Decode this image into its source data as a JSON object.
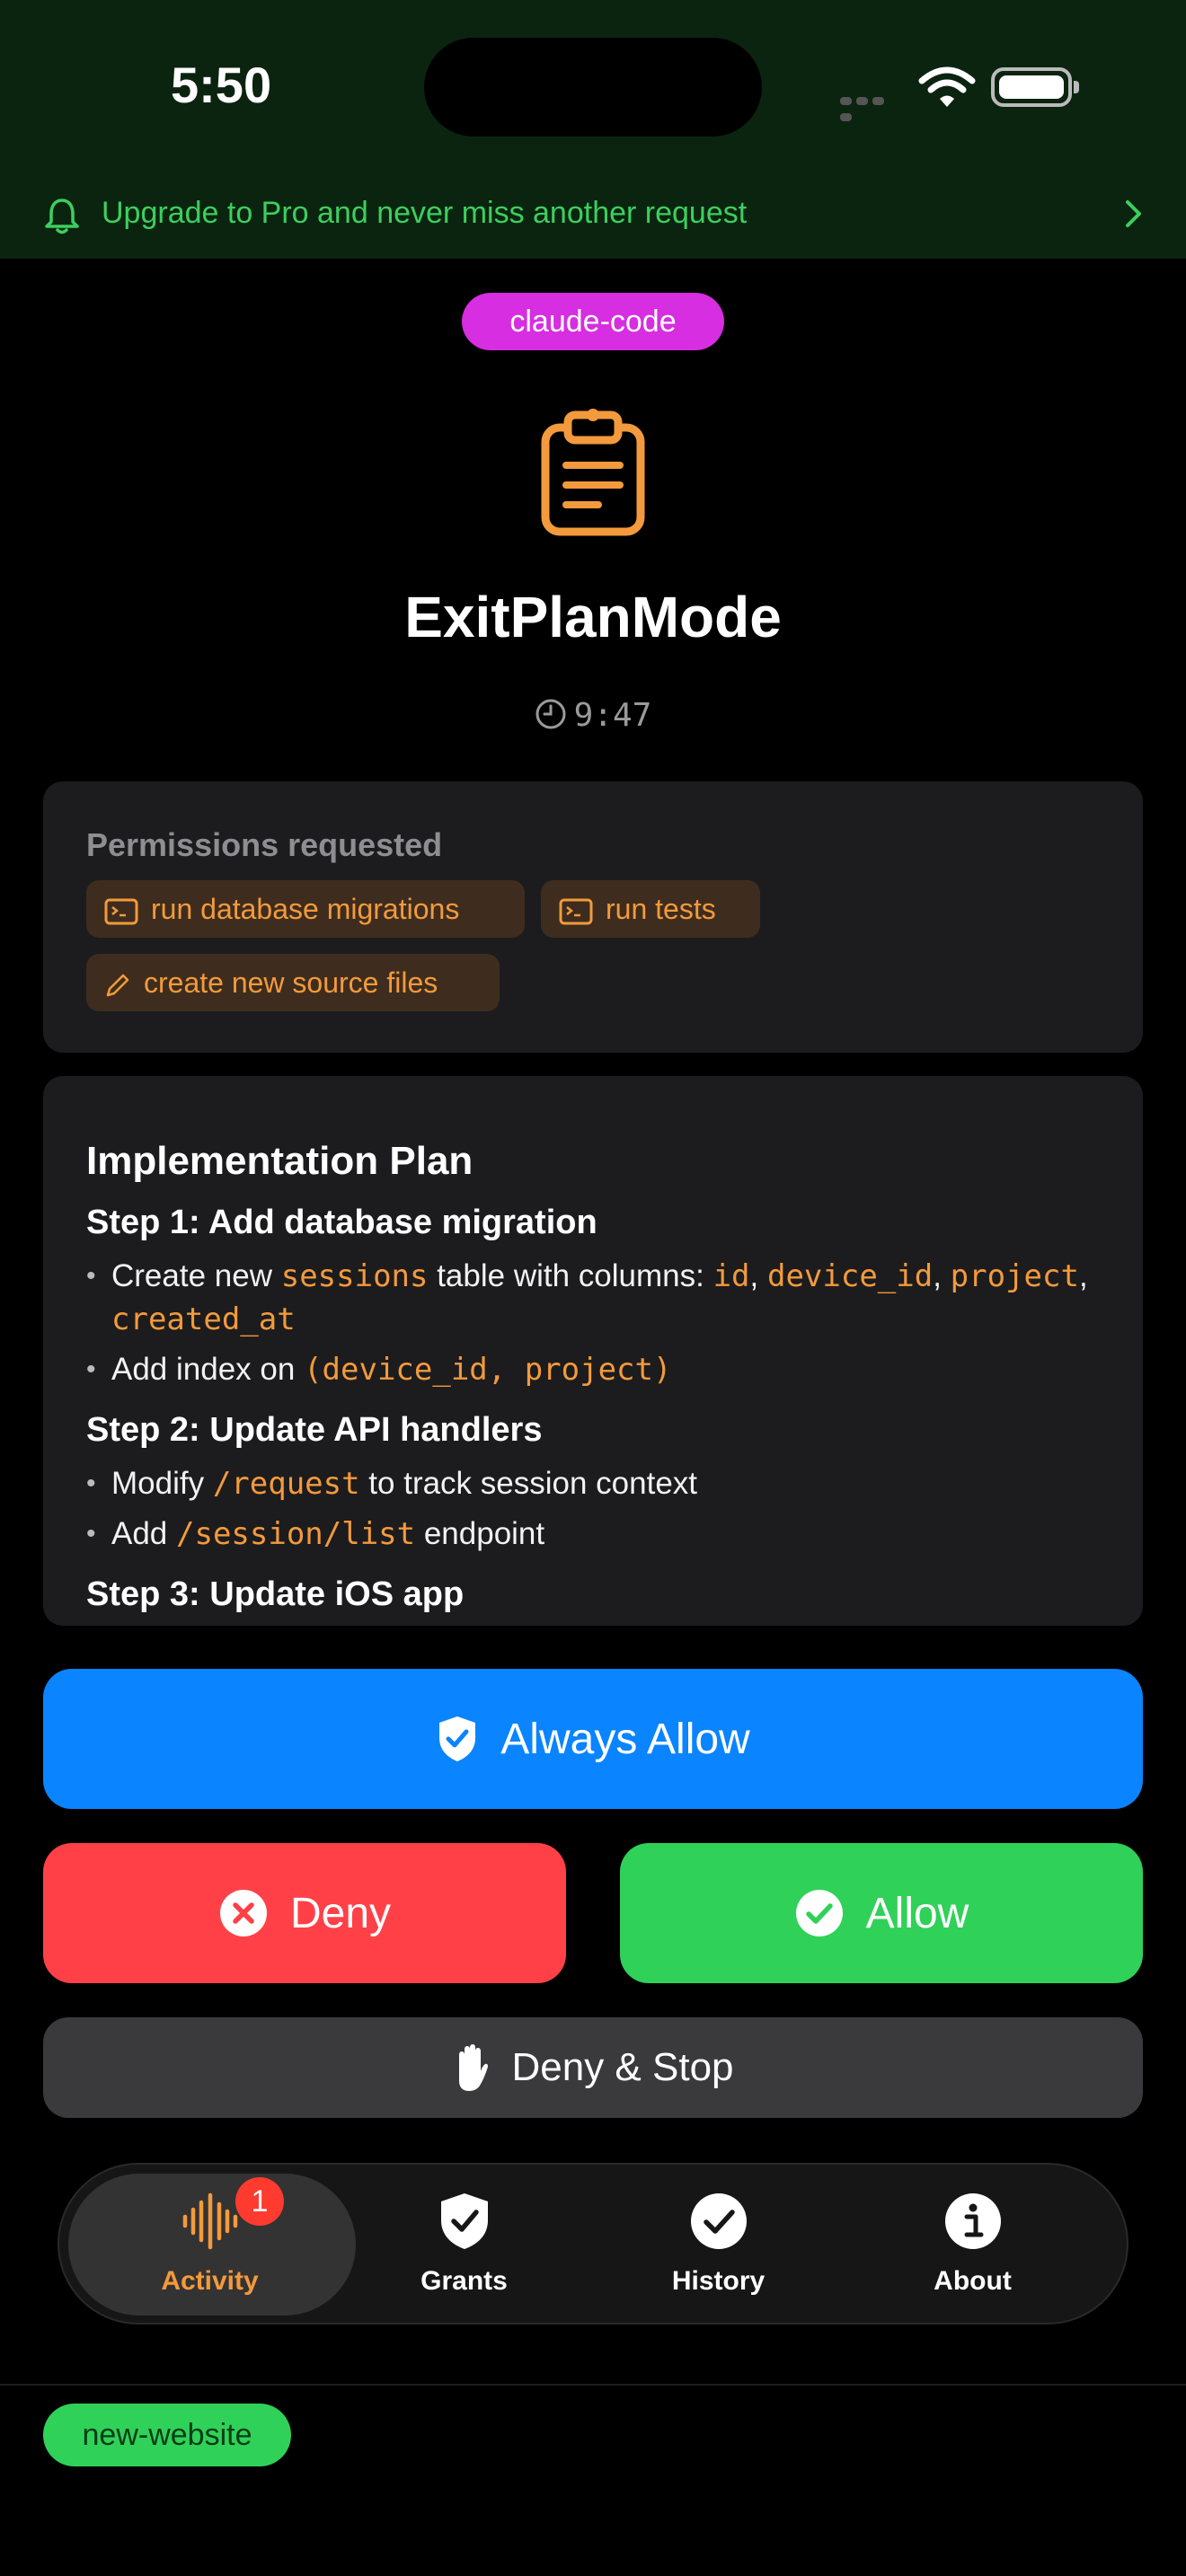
{
  "status": {
    "time": "5:50"
  },
  "banner": {
    "text": "Upgrade to Pro and never miss another request",
    "color": "#3ccf5e"
  },
  "request": {
    "project": "claude-code",
    "tool_name": "ExitPlanMode",
    "timestamp": "9:47",
    "permissions_label": "Permissions requested",
    "permissions": [
      {
        "icon": "terminal-icon",
        "label": "run database migrations"
      },
      {
        "icon": "terminal-icon",
        "label": "run tests"
      },
      {
        "icon": "pencil-icon",
        "label": "create new source files"
      }
    ]
  },
  "plan": {
    "title": "Implementation Plan",
    "step1": {
      "heading": "Step 1: Add database migration",
      "b1": {
        "t1": "Create new ",
        "c1": "sessions",
        "t2": " table with columns: ",
        "c2": "id",
        "t3": ", ",
        "c3": "device_id",
        "t4": ", ",
        "c4": "project",
        "t5": ", ",
        "c5": "created_at"
      },
      "b2": {
        "t1": "Add index on ",
        "c1": "(device_id, project)"
      }
    },
    "step2": {
      "heading": "Step 2: Update API handlers",
      "b1": {
        "t1": "Modify ",
        "c1": "/request",
        "t2": " to track session context"
      },
      "b2": {
        "t1": "Add ",
        "c1": "/session/list",
        "t2": " endpoint"
      }
    },
    "step3": {
      "heading": "Step 3: Update iOS app"
    }
  },
  "actions": {
    "always_allow": "Always Allow",
    "deny": "Deny",
    "allow": "Allow",
    "deny_stop": "Deny & Stop"
  },
  "tabs": [
    {
      "label": "Activity",
      "icon": "waveform-icon",
      "badge": "1",
      "active": true
    },
    {
      "label": "Grants",
      "icon": "shield-check-icon"
    },
    {
      "label": "History",
      "icon": "checkmark-circle-icon"
    },
    {
      "label": "About",
      "icon": "info-circle-icon"
    }
  ],
  "next_request": {
    "project": "new-website"
  },
  "colors": {
    "accent_orange": "#f39a3c",
    "blue": "#0a84ff",
    "red": "#ff4147",
    "green": "#30d158",
    "magenta": "#d62ee0"
  }
}
